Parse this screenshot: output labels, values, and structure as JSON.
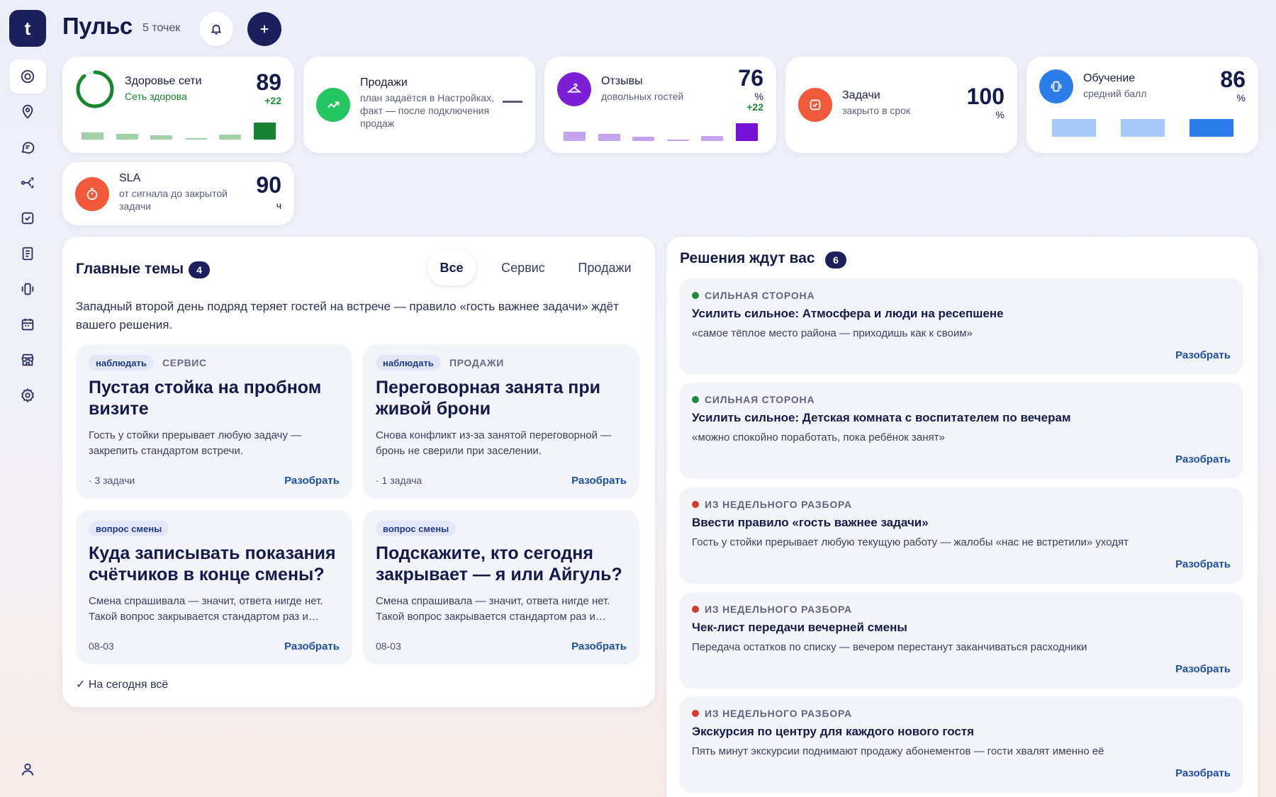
{
  "app": {
    "logo": "t"
  },
  "sidebar": {
    "items": [
      {
        "icon": "target-icon",
        "active": true
      },
      {
        "icon": "location-pin-icon"
      },
      {
        "icon": "chat-icon"
      },
      {
        "icon": "share-flow-icon"
      },
      {
        "icon": "checkbox-icon"
      },
      {
        "icon": "notebook-icon"
      },
      {
        "icon": "vibrate-icon"
      },
      {
        "icon": "calendar-icon"
      },
      {
        "icon": "store-icon"
      },
      {
        "icon": "settings-icon"
      }
    ],
    "profile_icon": "user-icon"
  },
  "header": {
    "title": "Пульс",
    "points": "5 точек",
    "bell_icon": "bell-icon",
    "add_icon": "plus-icon"
  },
  "metrics": [
    {
      "title": "Здоровье сети",
      "subtitle": "Сеть здорова",
      "value": "89",
      "delta": "+22",
      "progress": 0.89,
      "color": "#17862e",
      "bars": [
        0.35,
        0.3,
        0.2,
        0.08,
        0.25,
        0.85
      ]
    },
    {
      "title": "Продажи",
      "subtitle": "план задаётся в Настройках, факт — после подключения продаж",
      "value": "—",
      "icon": "trend-up-icon",
      "color": "#22c55e"
    },
    {
      "title": "Отзывы",
      "subtitle": "довольных гостей",
      "value": "76",
      "unit": "%",
      "delta": "+22",
      "icon": "hanger-icon",
      "color": "#7c1fd6",
      "bars": [
        0.5,
        0.4,
        0.25,
        0.05,
        0.28,
        1.0
      ]
    },
    {
      "title": "Задачи",
      "subtitle": "закрыто в срок",
      "value": "100",
      "unit": "%",
      "icon": "check-square-icon",
      "color": "#f05a3a"
    },
    {
      "title": "Обучение",
      "subtitle": "средний балл",
      "value": "86",
      "unit": "%",
      "icon": "vibrate-icon",
      "color": "#2b7de9",
      "bars": [
        1.0,
        1.0,
        1.0
      ]
    },
    {
      "title": "SLA",
      "subtitle": "от сигнала до закрытой задачи",
      "value": "90",
      "unit": "ч",
      "icon": "timer-icon",
      "color": "#f05a3a"
    }
  ],
  "topics_panel": {
    "title": "Главные темы",
    "count": "4",
    "tabs": [
      "Все",
      "Сервис",
      "Продажи"
    ],
    "active_tab": "Все",
    "lead": "Западный второй день подряд теряет гостей на встрече — правило «гость важнее задачи» ждёт вашего решения.",
    "cards": [
      {
        "pill": "наблюдать",
        "category": "СЕРВИС",
        "title": "Пустая стойка на пробном визите",
        "desc": "Гость у стойки прерывает любую задачу — закрепить стандартом встречи.",
        "meta": "· 3 задачи",
        "action": "Разобрать"
      },
      {
        "pill": "наблюдать",
        "category": "ПРОДАЖИ",
        "title": "Переговорная занята при живой брони",
        "desc": "Снова конфликт из-за занятой переговорной — бронь не сверили при заселении.",
        "meta": "· 1 задача",
        "action": "Разобрать"
      },
      {
        "pill": "вопрос смены",
        "category": "",
        "title": "Куда записывать показания счётчиков в конце смены?",
        "desc": "Смена спрашивала — значит, ответа нигде нет. Такой вопрос закрывается стандартом раз и…",
        "meta": "08-03",
        "action": "Разобрать"
      },
      {
        "pill": "вопрос смены",
        "category": "",
        "title": "Подскажите, кто сегодня закрывает — я или Айгуль?",
        "desc": "Смена спрашивала — значит, ответа нигде нет. Такой вопрос закрывается стандартом раз и…",
        "meta": "08-03",
        "action": "Разобрать"
      }
    ],
    "footer": "✓ На сегодня всё"
  },
  "decisions_panel": {
    "title": "Решения ждут вас",
    "count": "6",
    "items": [
      {
        "tag": "СИЛЬНАЯ СТОРОНА",
        "tag_color": "#1f8a3c",
        "title": "Усилить сильное: Атмосфера и люди на ресепшене",
        "desc": "«самое тёплое место района — приходишь как к своим»",
        "action": "Разобрать"
      },
      {
        "tag": "СИЛЬНАЯ СТОРОНА",
        "tag_color": "#1f8a3c",
        "title": "Усилить сильное: Детская комната с воспитателем по вечерам",
        "desc": "«можно спокойно поработать, пока ребёнок занят»",
        "action": "Разобрать"
      },
      {
        "tag": "ИЗ НЕДЕЛЬНОГО РАЗБОРА",
        "tag_color": "#d63a2f",
        "title": "Ввести правило «гость важнее задачи»",
        "desc": "Гость у стойки прерывает любую текущую работу — жалобы «нас не встретили» уходят",
        "action": "Разобрать"
      },
      {
        "tag": "ИЗ НЕДЕЛЬНОГО РАЗБОРА",
        "tag_color": "#d63a2f",
        "title": "Чек-лист передачи вечерней смены",
        "desc": "Передача остатков по списку — вечером перестанут заканчиваться расходники",
        "action": "Разобрать"
      },
      {
        "tag": "ИЗ НЕДЕЛЬНОГО РАЗБОРА",
        "tag_color": "#d63a2f",
        "title": "Экскурсия по центру для каждого нового гостя",
        "desc": "Пять минут экскурсии поднимают продажу абонементов — гости хвалят именно её",
        "action": "Разобрать"
      }
    ]
  }
}
